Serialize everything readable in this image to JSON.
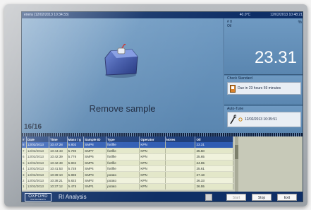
{
  "titlebar": {
    "left_text": "enera (12/02/2013 10:34:33)",
    "right_1": "40.0°C",
    "right_2": "12/02/2013 10:48:21"
  },
  "main": {
    "instruction": "Remove sample",
    "counter": "16/16"
  },
  "reading": {
    "label_line1": "# 0",
    "label_line2": "Oil",
    "pct": "%",
    "value": "23.31"
  },
  "check_standard": {
    "title": "Check Standard",
    "due_text": "Due in 23 hours 59 minutes"
  },
  "auto_tune": {
    "title": "Auto-Tune",
    "timestamp": "12/02/2013 10:35:51"
  },
  "table": {
    "headers": [
      "#",
      "Date",
      "Time",
      "Mass / g",
      "Sample ID",
      "Type",
      "Operator",
      "Notes",
      "Oil"
    ],
    "rows": [
      [
        "8",
        "12/02/2013",
        "10:47:28",
        "5.802",
        "SMP8",
        "fortlfie",
        "KPN",
        "",
        "23.31"
      ],
      [
        "7",
        "12/02/2013",
        "10:44:43",
        "5.790",
        "SMP7",
        "fortlfie",
        "KPN",
        "",
        "25.50"
      ],
      [
        "6",
        "12/02/2013",
        "10:42:39",
        "5.776",
        "SMP6",
        "fortlfie",
        "KPN",
        "",
        "25.65"
      ],
      [
        "5",
        "12/02/2013",
        "10:42:49",
        "5.804",
        "SMP5",
        "fortlfie",
        "KPN",
        "",
        "24.65"
      ],
      [
        "4",
        "12/02/2013",
        "10:41:53",
        "5.728",
        "SMP4",
        "fortlfie",
        "KPN",
        "",
        "25.61"
      ],
      [
        "3",
        "12/02/2013",
        "10:39:10",
        "5.886",
        "SMP3",
        "potato",
        "KPN",
        "",
        "27.18"
      ],
      [
        "2",
        "12/02/2013",
        "10:38:21",
        "5.823",
        "SMP2",
        "potato",
        "KPN",
        "",
        "26.33"
      ],
      [
        "1",
        "12/02/2013",
        "10:37:12",
        "5.475",
        "SMP1",
        "potato",
        "KPN",
        "",
        "26.55"
      ]
    ]
  },
  "bottombar": {
    "logo_big": "OXFORD",
    "logo_small": "INSTRUMENTS",
    "app_name": "RI Analysis",
    "start_label": "Start",
    "stop_label": "Stop",
    "exit_label": "Exit"
  }
}
